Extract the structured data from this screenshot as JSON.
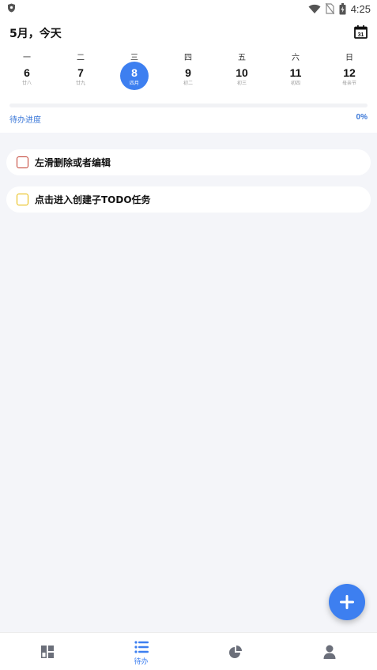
{
  "status_bar": {
    "time": "4:25"
  },
  "header": {
    "title": "5月，今天"
  },
  "calendar": {
    "weekdays": [
      "一",
      "二",
      "三",
      "四",
      "五",
      "六",
      "日"
    ],
    "days": [
      {
        "num": "6",
        "lunar": "廿八"
      },
      {
        "num": "7",
        "lunar": "廿九"
      },
      {
        "num": "8",
        "lunar": "四月"
      },
      {
        "num": "9",
        "lunar": "初二"
      },
      {
        "num": "10",
        "lunar": "初三"
      },
      {
        "num": "11",
        "lunar": "初四"
      },
      {
        "num": "12",
        "lunar": "母亲节"
      }
    ],
    "selected_day": "8"
  },
  "progress": {
    "label": "待办进度",
    "value_text": "0%",
    "value": 0
  },
  "tasks": [
    {
      "label": "左滑删除或者编辑",
      "checkbox_color": "#c0392b"
    },
    {
      "label": "点击进入创建子TODO任务",
      "checkbox_color": "#e6b800"
    }
  ],
  "bottom_nav": {
    "items": [
      {
        "icon": "dashboard-icon",
        "label": ""
      },
      {
        "icon": "list-icon",
        "label": "待办"
      },
      {
        "icon": "pie-chart-icon",
        "label": ""
      },
      {
        "icon": "user-icon",
        "label": ""
      }
    ]
  },
  "colors": {
    "accent": "#3d7ff0",
    "background": "#f4f5f9"
  }
}
